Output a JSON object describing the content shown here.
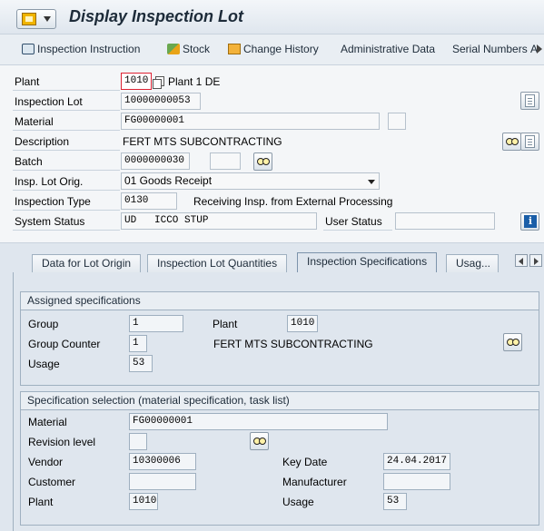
{
  "title": "Display Inspection Lot",
  "toolbar": {
    "inspection_instruction": "Inspection Instruction",
    "stock": "Stock",
    "change_history": "Change History",
    "administrative_data": "Administrative Data",
    "serial_numbers": "Serial Numbers",
    "overflow": "A"
  },
  "header": {
    "plant_label": "Plant",
    "plant_value": "1010",
    "plant_text": "Plant 1 DE",
    "inspection_lot_label": "Inspection Lot",
    "inspection_lot_value": "10000000053",
    "material_label": "Material",
    "material_value": "FG00000001",
    "description_label": "Description",
    "description_value": "FERT MTS SUBCONTRACTING",
    "batch_label": "Batch",
    "batch_value": "0000000030",
    "insp_lot_orig_label": "Insp. Lot Orig.",
    "insp_lot_orig_value": "01 Goods Receipt",
    "inspection_type_label": "Inspection Type",
    "inspection_type_value": "0130",
    "inspection_type_text": "Receiving Insp. from External Processing",
    "system_status_label": "System Status",
    "system_status_value": "UD   ICCO STUP",
    "user_status_label": "User Status",
    "user_status_value": ""
  },
  "tabs": [
    {
      "label": "Data for Lot Origin"
    },
    {
      "label": "Inspection Lot Quantities"
    },
    {
      "label": "Inspection Specifications"
    },
    {
      "label": "Usag..."
    }
  ],
  "assigned": {
    "title": "Assigned specifications",
    "group_label": "Group",
    "group_value": "1",
    "plant_label": "Plant",
    "plant_value": "1010",
    "group_counter_label": "Group Counter",
    "group_counter_value": "1",
    "group_text": "FERT MTS SUBCONTRACTING",
    "usage_label": "Usage",
    "usage_value": "53"
  },
  "selection": {
    "title": "Specification selection (material specification, task list)",
    "material_label": "Material",
    "material_value": "FG00000001",
    "revision_label": "Revision level",
    "revision_value": "",
    "vendor_label": "Vendor",
    "vendor_value": "10300006",
    "key_date_label": "Key Date",
    "key_date_value": "24.04.2017",
    "customer_label": "Customer",
    "customer_value": "",
    "manufacturer_label": "Manufacturer",
    "manufacturer_value": "",
    "plant_label": "Plant",
    "plant_value": "1010",
    "usage_label": "Usage",
    "usage_value": "53"
  }
}
